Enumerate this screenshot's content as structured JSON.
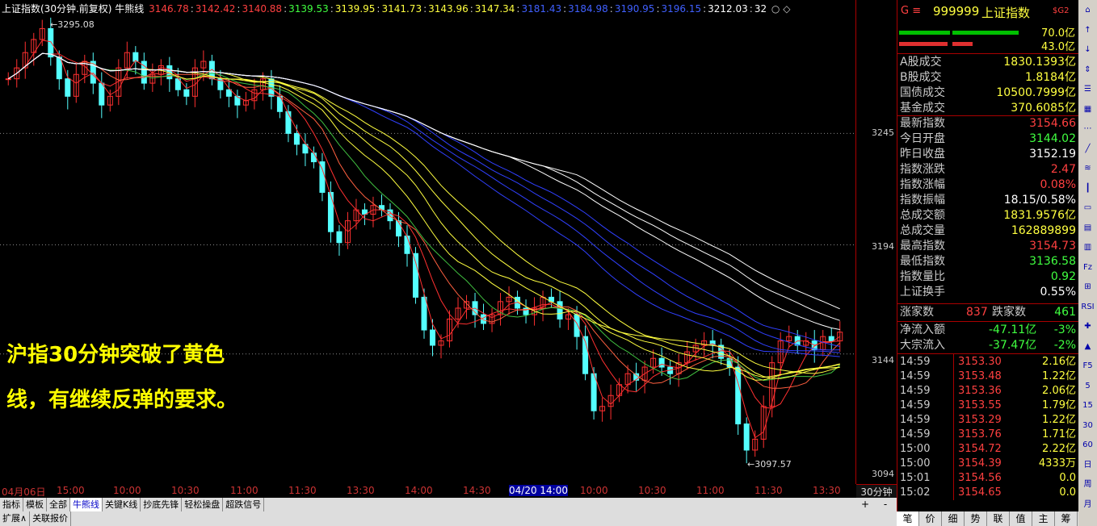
{
  "chart": {
    "title": "上证指数(30分钟.前复权) 牛熊线",
    "ma_values": [
      {
        "text": "3146.78",
        "color": "#ff4040"
      },
      {
        "text": "3142.42",
        "color": "#ff4040"
      },
      {
        "text": "3140.88",
        "color": "#ff4040"
      },
      {
        "text": "3139.53",
        "color": "#40ff40"
      },
      {
        "text": "3139.95",
        "color": "#ffff40"
      },
      {
        "text": "3141.73",
        "color": "#ffff40"
      },
      {
        "text": "3143.96",
        "color": "#ffff40"
      },
      {
        "text": "3147.34",
        "color": "#ffff40"
      },
      {
        "text": "3181.43",
        "color": "#4060ff"
      },
      {
        "text": "3184.98",
        "color": "#4060ff"
      },
      {
        "text": "3190.95",
        "color": "#4060ff"
      },
      {
        "text": "3196.15",
        "color": "#4060ff"
      },
      {
        "text": "3212.03",
        "color": "#ffffff"
      },
      {
        "text": "32",
        "color": "#ffffff"
      }
    ],
    "high_label": "3295.08",
    "low_label": "3097.57",
    "price_labels": [
      "3245",
      "3194",
      "3144",
      "3094"
    ],
    "time_labels": [
      "04月06日",
      "15:00",
      "10:00",
      "10:30",
      "11:00",
      "11:30",
      "13:30",
      "14:00",
      "14:30",
      "04/20 14:00",
      "10:00",
      "10:30",
      "11:00",
      "11:30",
      "13:30"
    ],
    "period": "30分钟",
    "annotation_lines": [
      "沪指30分钟突破了黄色",
      "线，有继续反弹的要求。"
    ],
    "colors": {
      "up": "#ff3030",
      "down": "#54ffff"
    }
  },
  "tabs": [
    "指标",
    "模板",
    "全部",
    "牛熊线",
    "关键K线",
    "抄底先锋",
    "轻松操盘",
    "超跌信号"
  ],
  "tabs2": [
    "扩展∧",
    "关联报价"
  ],
  "scroll": [
    "+",
    "-"
  ],
  "panel": {
    "code": "999999",
    "name": "上证指数",
    "badge": "$G2",
    "prefix": "G ≡",
    "bar_labels": [
      "70.0亿",
      "43.0亿"
    ],
    "rows": [
      {
        "k": "A股成交",
        "v": "1830.1393亿",
        "c": "#ffff40"
      },
      {
        "k": "B股成交",
        "v": "1.8184亿",
        "c": "#ffff40"
      },
      {
        "k": "国债成交",
        "v": "10500.7999亿",
        "c": "#ffff40"
      },
      {
        "k": "基金成交",
        "v": "370.6085亿",
        "c": "#ffff40"
      },
      {
        "k": "最新指数",
        "v": "3154.66",
        "c": "#ff4040"
      },
      {
        "k": "今日开盘",
        "v": "3144.02",
        "c": "#40ff40"
      },
      {
        "k": "昨日收盘",
        "v": "3152.19",
        "c": "#ffffff"
      },
      {
        "k": "指数涨跌",
        "v": "2.47",
        "c": "#ff4040"
      },
      {
        "k": "指数涨幅",
        "v": "0.08%",
        "c": "#ff4040"
      },
      {
        "k": "指数振幅",
        "v": "18.15/0.58%",
        "c": "#ffffff"
      },
      {
        "k": "总成交额",
        "v": "1831.9576亿",
        "c": "#ffff40"
      },
      {
        "k": "总成交量",
        "v": "162889899",
        "c": "#ffff40"
      },
      {
        "k": "最高指数",
        "v": "3154.73",
        "c": "#ff4040"
      },
      {
        "k": "最低指数",
        "v": "3136.58",
        "c": "#40ff40"
      },
      {
        "k": "指数量比",
        "v": "0.92",
        "c": "#40ff40"
      },
      {
        "k": "上证换手",
        "v": "0.55%",
        "c": "#ffffff"
      }
    ],
    "updown": {
      "up_label": "涨家数",
      "up": "837",
      "down_label": "跌家数",
      "down": "461"
    },
    "flows": [
      {
        "k": "净流入额",
        "v": "-47.11亿",
        "p": "-3%"
      },
      {
        "k": "大宗流入",
        "v": "-37.47亿",
        "p": "-2%"
      }
    ],
    "ticks": [
      {
        "t": "14:59",
        "p": "3153.30",
        "v": "2.16亿"
      },
      {
        "t": "14:59",
        "p": "3153.48",
        "v": "1.22亿"
      },
      {
        "t": "14:59",
        "p": "3153.36",
        "v": "2.06亿"
      },
      {
        "t": "14:59",
        "p": "3153.55",
        "v": "1.79亿"
      },
      {
        "t": "14:59",
        "p": "3153.29",
        "v": "1.22亿"
      },
      {
        "t": "14:59",
        "p": "3153.76",
        "v": "1.71亿"
      },
      {
        "t": "15:00",
        "p": "3154.72",
        "v": "2.22亿"
      },
      {
        "t": "15:00",
        "p": "3154.39",
        "v": "4333万"
      },
      {
        "t": "15:01",
        "p": "3154.56",
        "v": "0.0"
      },
      {
        "t": "15:02",
        "p": "3154.65",
        "v": "0.0"
      }
    ],
    "bottom_tabs": [
      "笔",
      "价",
      "细",
      "势",
      "联",
      "值",
      "主",
      "筹"
    ]
  },
  "toolbar": [
    "⌂",
    "↑",
    "↓",
    "⇕",
    "☰",
    "▦",
    "⋯",
    "╱",
    "≋",
    "┃",
    "▭",
    "▤",
    "▥",
    "Fz",
    "⊞",
    "RSI",
    "✚",
    "▲",
    "F5",
    "5",
    "15",
    "30",
    "60",
    "日",
    "周",
    "月"
  ]
}
